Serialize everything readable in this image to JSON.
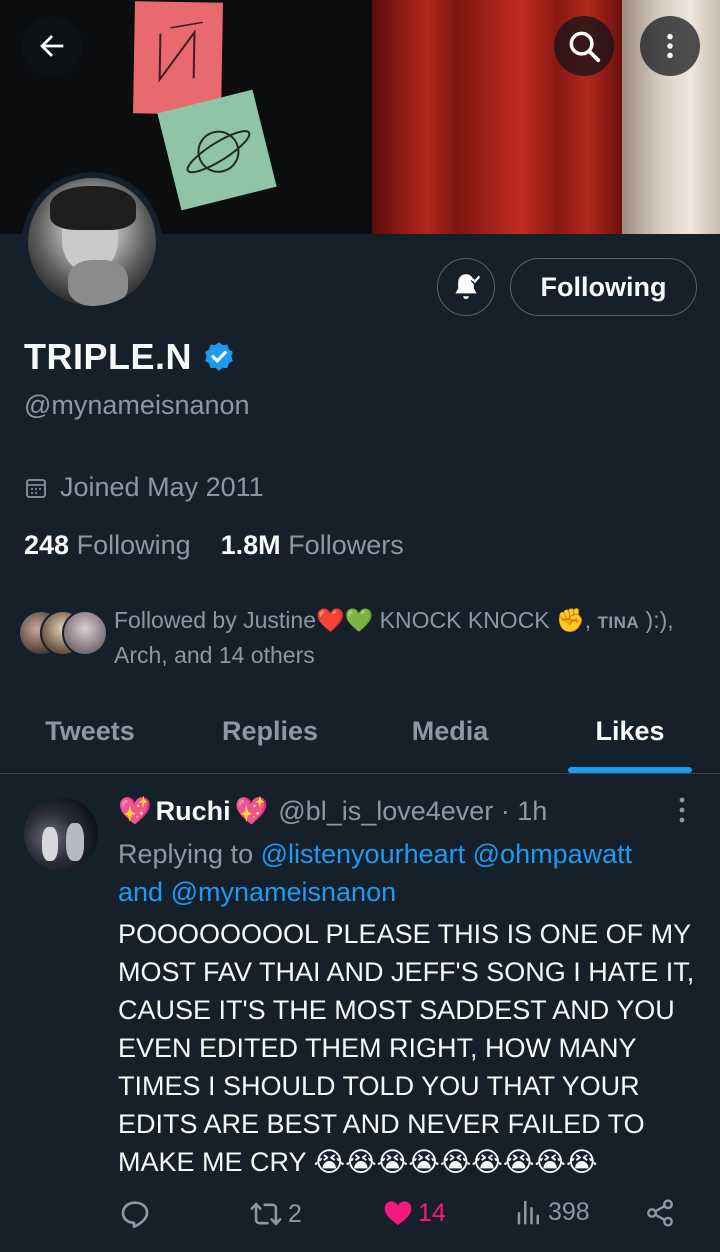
{
  "profile": {
    "name": "TRIPLE.N",
    "handle": "@mynameisnanon",
    "joined": "Joined May 2011",
    "following_count": "248",
    "following_label": "Following",
    "followers_count": "1.8M",
    "followers_label": "Followers",
    "follow_button_label": "Following",
    "followed_by": {
      "prefix": "Followed by Justine",
      "hearts": "❤️💚",
      "name2": " KNOCK KNOCK ",
      "fist": "✊",
      "sep": ", ",
      "tina": "TINA",
      "tina_tail": " ):),",
      "line2": "Arch, and 14 others"
    }
  },
  "tabs": [
    {
      "label": "Tweets",
      "active": false
    },
    {
      "label": "Replies",
      "active": false
    },
    {
      "label": "Media",
      "active": false
    },
    {
      "label": "Likes",
      "active": true
    }
  ],
  "tweet": {
    "name_prefix_emoji": "💖",
    "name": "Ruchi",
    "name_suffix_emoji": "💖",
    "handle_time": "@bl_is_love4ever · 1h",
    "replying_label": "Replying to",
    "mention1": "@listenyourheart",
    "mention2": "@ohmpawatt",
    "and_label": "and",
    "mention3": "@mynameisnanon",
    "body": "POOOOOOOOL PLEASE THIS IS ONE OF MY MOST FAV THAI AND JEFF'S SONG I HATE IT, CAUSE IT'S THE MOST SADDEST AND YOU EVEN EDITED THEM RIGHT, HOW MANY TIMES  I SHOULD TOLD YOU THAT YOUR EDITS ARE BEST AND NEVER FAILED TO MAKE ME CRY 😭😭😭😭😭😭😭😭😭",
    "retweets": "2",
    "likes": "14",
    "views": "398"
  },
  "colors": {
    "background": "#15202b",
    "accent": "#1d9bf0",
    "muted": "#8b98a5",
    "like": "#f91880"
  },
  "icons": [
    "back-arrow-icon",
    "search-icon",
    "more-vertical-icon",
    "notification-bell-icon",
    "verified-badge-icon",
    "calendar-icon",
    "reply-icon",
    "retweet-icon",
    "heart-icon",
    "views-icon",
    "share-icon"
  ]
}
